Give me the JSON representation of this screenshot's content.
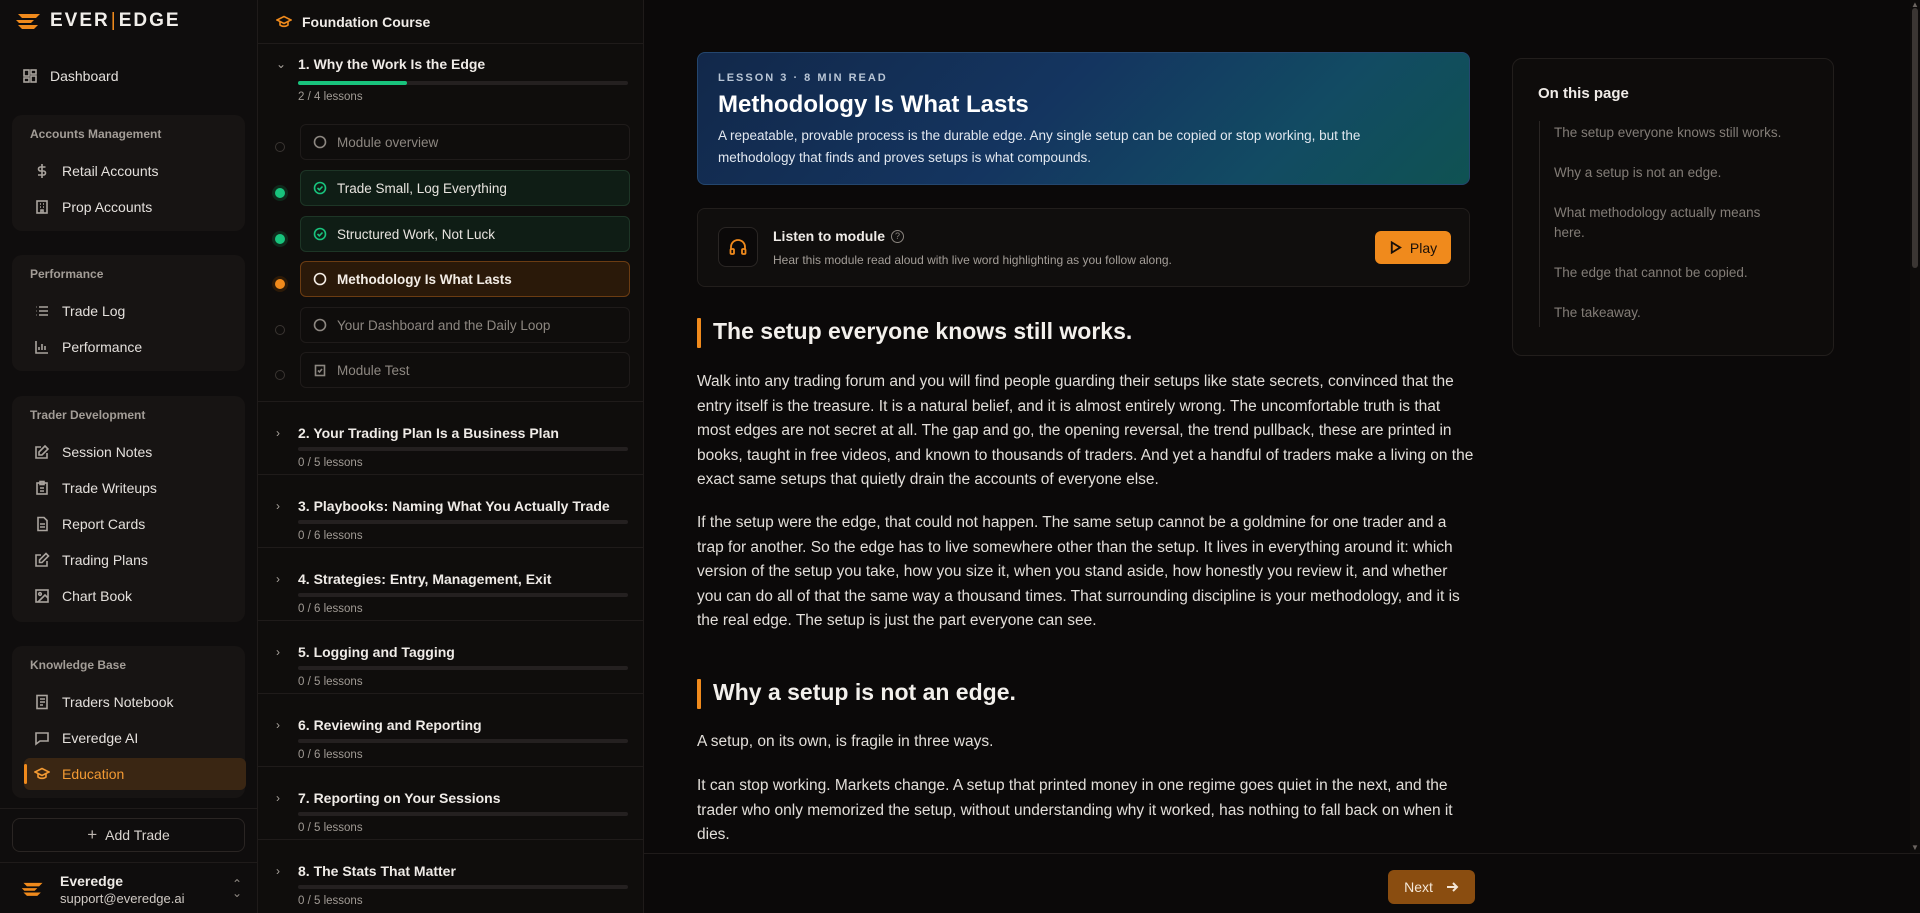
{
  "brand": {
    "name_left": "EVER",
    "name_sep": "|",
    "name_right": "EDGE",
    "accent": "#f08a1c"
  },
  "sidebar": {
    "dashboard": "Dashboard",
    "groups": [
      {
        "title": "Accounts Management",
        "items": [
          {
            "label": "Retail Accounts",
            "icon": "dollar-icon"
          },
          {
            "label": "Prop Accounts",
            "icon": "building-icon"
          }
        ]
      },
      {
        "title": "Performance",
        "items": [
          {
            "label": "Trade Log",
            "icon": "list-icon"
          },
          {
            "label": "Performance",
            "icon": "bar-chart-icon"
          }
        ]
      },
      {
        "title": "Trader Development",
        "items": [
          {
            "label": "Session Notes",
            "icon": "note-edit-icon"
          },
          {
            "label": "Trade Writeups",
            "icon": "clipboard-icon"
          },
          {
            "label": "Report Cards",
            "icon": "document-icon"
          },
          {
            "label": "Trading Plans",
            "icon": "pencil-square-icon"
          },
          {
            "label": "Chart Book",
            "icon": "image-icon"
          }
        ]
      },
      {
        "title": "Knowledge Base",
        "items": [
          {
            "label": "Traders Notebook",
            "icon": "notebook-icon"
          },
          {
            "label": "Everedge AI",
            "icon": "chat-icon"
          },
          {
            "label": "Education",
            "icon": "graduation-cap-icon",
            "active": true
          }
        ]
      }
    ],
    "add_trade": "Add Trade",
    "user": {
      "name": "Everedge",
      "email": "support@everedge.ai"
    }
  },
  "course": {
    "title": "Foundation Course",
    "modules": [
      {
        "title": "1. Why the Work Is the Edge",
        "count": "2 / 4 lessons",
        "progress": 0.33,
        "expanded": true,
        "lessons": [
          {
            "label": "Module overview",
            "state": "todo"
          },
          {
            "label": "Trade Small, Log Everything",
            "state": "done"
          },
          {
            "label": "Structured Work, Not Luck",
            "state": "done"
          },
          {
            "label": "Methodology Is What Lasts",
            "state": "current"
          },
          {
            "label": "Your Dashboard and the Daily Loop",
            "state": "todo"
          },
          {
            "label": "Module Test",
            "state": "test"
          }
        ]
      },
      {
        "title": "2. Your Trading Plan Is a Business Plan",
        "count": "0 / 5 lessons",
        "progress": 0
      },
      {
        "title": "3. Playbooks: Naming What You Actually Trade",
        "count": "0 / 6 lessons",
        "progress": 0
      },
      {
        "title": "4. Strategies: Entry, Management, Exit",
        "count": "0 / 6 lessons",
        "progress": 0
      },
      {
        "title": "5. Logging and Tagging",
        "count": "0 / 5 lessons",
        "progress": 0
      },
      {
        "title": "6. Reviewing and Reporting",
        "count": "0 / 6 lessons",
        "progress": 0
      },
      {
        "title": "7. Reporting on Your Sessions",
        "count": "0 / 5 lessons",
        "progress": 0
      },
      {
        "title": "8. The Stats That Matter",
        "count": "0 / 5 lessons",
        "progress": 0
      }
    ]
  },
  "lesson": {
    "kicker": "LESSON 3 · 8 MIN READ",
    "title": "Methodology Is What Lasts",
    "description": "A repeatable, provable process is the durable edge. Any single setup can be copied or stop working, but the methodology that finds and proves setups is what compounds.",
    "listen": {
      "title": "Listen to module",
      "subtitle": "Hear this module read aloud with live word highlighting as you follow along.",
      "play": "Play"
    },
    "sections": [
      {
        "heading": "The setup everyone knows still works.",
        "paragraphs": [
          "Walk into any trading forum and you will find people guarding their setups like state secrets, convinced that the entry itself is the treasure. It is a natural belief, and it is almost entirely wrong. The uncomfortable truth is that most edges are not secret at all. The gap and go, the opening reversal, the trend pullback, these are printed in books, taught in free videos, and known to thousands of traders. And yet a handful of traders make a living on the exact same setups that quietly drain the accounts of everyone else.",
          "If the setup were the edge, that could not happen. The same setup cannot be a goldmine for one trader and a trap for another. So the edge has to live somewhere other than the setup. It lives in everything around it: which version of the setup you take, how you size it, when you stand aside, how honestly you review it, and whether you can do all of that the same way a thousand times. That surrounding discipline is your methodology, and it is the real edge. The setup is just the part everyone can see."
        ]
      },
      {
        "heading": "Why a setup is not an edge.",
        "paragraphs": [
          "A setup, on its own, is fragile in three ways.",
          "It can stop working. Markets change. A setup that printed money in one regime goes quiet in the next, and the trader who only memorized the setup, without understanding why it worked, has nothing to fall back on when it dies."
        ]
      }
    ],
    "next": "Next"
  },
  "toc": {
    "title": "On this page",
    "items": [
      "The setup everyone knows still works.",
      "Why a setup is not an edge.",
      "What methodology actually means here.",
      "The edge that cannot be copied.",
      "The takeaway."
    ]
  }
}
